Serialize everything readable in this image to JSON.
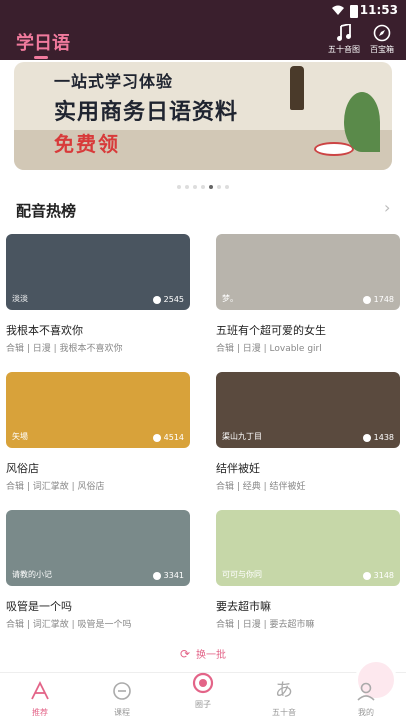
{
  "status": {
    "time": "11:53"
  },
  "header": {
    "title": "学日语",
    "buttons": [
      {
        "label": "五十音图",
        "icon": "music-note-icon"
      },
      {
        "label": "百宝箱",
        "icon": "compass-icon"
      }
    ]
  },
  "banner": {
    "line1": "一站式学习体验",
    "line2": "实用商务日语资料",
    "line3": "免费领"
  },
  "carousel": {
    "count": 7,
    "active_index": 4
  },
  "section": {
    "title": "配音热榜"
  },
  "cards": [
    {
      "title": "我根本不喜欢你",
      "subtitle": "合辑 | 日漫 | 我根本不喜欢你",
      "tag": "淡淡",
      "count": "2545",
      "color": "#4a5560"
    },
    {
      "title": "五班有个超可爱的女生",
      "subtitle": "合辑 | 日漫 | Lovable girl",
      "tag": "梦。",
      "count": "1748",
      "color": "#b8b4ac"
    },
    {
      "title": "风俗店",
      "subtitle": "合辑 | 词汇掌故 | 风俗店",
      "tag": "矢場",
      "count": "4514",
      "color": "#d8a23a"
    },
    {
      "title": "结伴被妊",
      "subtitle": "合辑 | 经典 | 结伴被妊",
      "tag": "渠山九丁目",
      "count": "1438",
      "color": "#5a4a3e"
    },
    {
      "title": "吸管是一个吗",
      "subtitle": "合辑 | 词汇掌故 | 吸管是一个吗",
      "tag": "请教的小记",
      "count": "3341",
      "color": "#7a8a8a"
    },
    {
      "title": "要去超市嘛",
      "subtitle": "合辑 | 日漫 | 要去超市嘛",
      "tag": "可可与你同",
      "count": "3148",
      "color": "#c6d7a8"
    }
  ],
  "refresh": {
    "label": "换一批"
  },
  "tabs": [
    {
      "label": "推荐",
      "icon": "home-icon",
      "active": true
    },
    {
      "label": "课程",
      "icon": "course-icon",
      "active": false
    },
    {
      "label": "圈子",
      "icon": "circle-icon",
      "active": false
    },
    {
      "label": "五十音",
      "icon": "kana-icon",
      "active": false
    },
    {
      "label": "我的",
      "icon": "profile-icon",
      "active": false
    }
  ]
}
